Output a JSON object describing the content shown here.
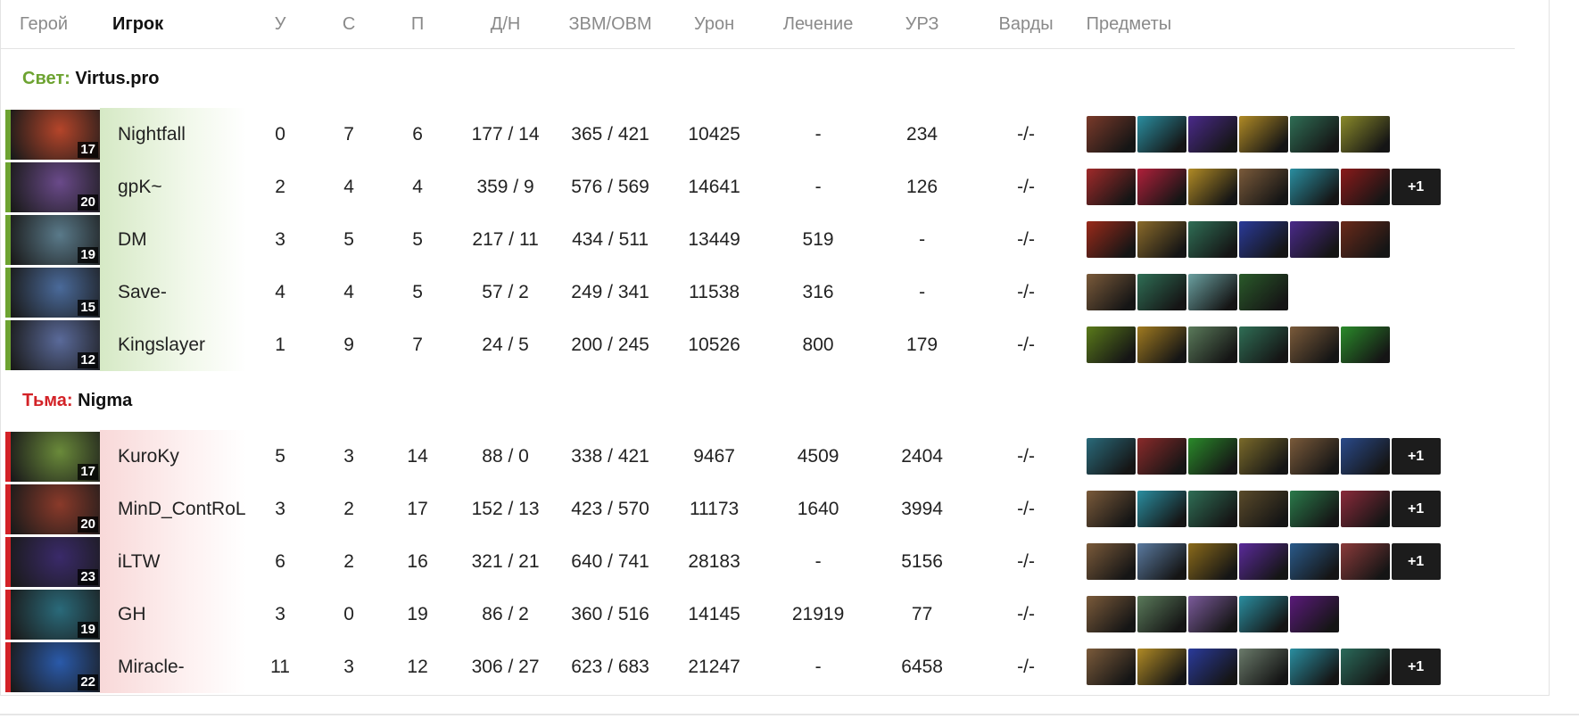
{
  "headers": {
    "hero": "Герой",
    "player": "Игрок",
    "kills": "У",
    "deaths": "С",
    "assists": "П",
    "lh_dn": "Д/Н",
    "gpm_xpm": "ЗВМ/ОВМ",
    "damage": "Урон",
    "healing": "Лечение",
    "building_damage": "УРЗ",
    "wards": "Варды",
    "items": "Предметы"
  },
  "teams": [
    {
      "side": "radiant",
      "side_label": "Свет:",
      "name": "Virtus.pro",
      "side_color": "#6da331",
      "players": [
        {
          "hero_icon": "hero-bearded-warrior-icon",
          "hero_color": "#b5452a",
          "level": "17",
          "name": "Nightfall",
          "k": "0",
          "d": "7",
          "a": "6",
          "lh": "177 / 14",
          "gx": "365 / 421",
          "dmg": "10425",
          "heal": "-",
          "bld": "234",
          "wards": "-/-",
          "items": [
            {
              "icon": "item-gauntlet-icon",
              "color": "#7a3a2a"
            },
            {
              "icon": "item-axe-blade-icon",
              "color": "#2a8ea0"
            },
            {
              "icon": "item-purple-robe-icon",
              "color": "#4a2a8a"
            },
            {
              "icon": "item-golden-helm-icon",
              "color": "#b08a25"
            },
            {
              "icon": "item-green-staff-icon",
              "color": "#2f6e55"
            },
            {
              "icon": "item-yellow-orb-icon",
              "color": "#8a8a2a"
            }
          ],
          "more": ""
        },
        {
          "hero_icon": "hero-masked-assassin-icon",
          "hero_color": "#6a4a8a",
          "level": "20",
          "name": "gpK~",
          "k": "2",
          "d": "4",
          "a": "4",
          "lh": "359 / 9",
          "gx": "576 / 569",
          "dmg": "14641",
          "heal": "-",
          "bld": "126",
          "wards": "-/-",
          "items": [
            {
              "icon": "item-red-blade-icon",
              "color": "#a02a2a"
            },
            {
              "icon": "item-crimson-cape-icon",
              "color": "#b0203a"
            },
            {
              "icon": "item-golden-helm-icon",
              "color": "#b08a25"
            },
            {
              "icon": "item-boots-icon",
              "color": "#7a5a3a"
            },
            {
              "icon": "item-axe-blade-icon",
              "color": "#2a8ea0"
            },
            {
              "icon": "item-red-claw-icon",
              "color": "#8a1a1a"
            }
          ],
          "more": "+1"
        },
        {
          "hero_icon": "hero-dwarf-icon",
          "hero_color": "#5a7a8a",
          "level": "19",
          "name": "DM",
          "k": "3",
          "d": "5",
          "a": "5",
          "lh": "217 / 11",
          "gx": "434 / 511",
          "dmg": "13449",
          "heal": "519",
          "bld": "-",
          "wards": "-/-",
          "items": [
            {
              "icon": "item-fire-shield-icon",
              "color": "#9a2a1a"
            },
            {
              "icon": "item-lantern-icon",
              "color": "#8a6a2a"
            },
            {
              "icon": "item-green-staff-icon",
              "color": "#2f6e55"
            },
            {
              "icon": "item-blue-scepter-icon",
              "color": "#2a3a9a"
            },
            {
              "icon": "item-purple-robe-icon",
              "color": "#4a2a8a"
            },
            {
              "icon": "item-hood-icon",
              "color": "#6a2a1a"
            }
          ],
          "more": ""
        },
        {
          "hero_icon": "hero-sorceress-icon",
          "hero_color": "#4a6a9a",
          "level": "15",
          "name": "Save-",
          "k": "4",
          "d": "4",
          "a": "5",
          "lh": "57 / 2",
          "gx": "249 / 341",
          "dmg": "11538",
          "heal": "316",
          "bld": "-",
          "wards": "-/-",
          "items": [
            {
              "icon": "item-boots-icon",
              "color": "#7a5a3a"
            },
            {
              "icon": "item-green-staff-icon",
              "color": "#2f6e55"
            },
            {
              "icon": "item-wind-cloud-icon",
              "color": "#6aa0a0"
            },
            {
              "icon": "item-green-ring-icon",
              "color": "#2a5a2a"
            }
          ],
          "more": ""
        },
        {
          "hero_icon": "hero-goblin-icon",
          "hero_color": "#5a6a9a",
          "level": "12",
          "name": "Kingslayer",
          "k": "1",
          "d": "9",
          "a": "7",
          "lh": "24 / 5",
          "gx": "200 / 245",
          "dmg": "10526",
          "heal": "800",
          "bld": "179",
          "wards": "-/-",
          "items": [
            {
              "icon": "item-green-trident-icon",
              "color": "#5a7a1a"
            },
            {
              "icon": "item-gold-pile-icon",
              "color": "#a07a20"
            },
            {
              "icon": "item-teal-mech-icon",
              "color": "#5a7a5a"
            },
            {
              "icon": "item-green-staff-icon",
              "color": "#2f6e55"
            },
            {
              "icon": "item-boots-icon",
              "color": "#7a5a3a"
            },
            {
              "icon": "item-green-potion-icon",
              "color": "#2a8a2a"
            }
          ],
          "more": ""
        }
      ]
    },
    {
      "side": "dire",
      "side_label": "Тьма:",
      "name": "Nigma",
      "side_color": "#d32227",
      "players": [
        {
          "hero_icon": "hero-nature-archer-icon",
          "hero_color": "#6a8a3a",
          "level": "17",
          "name": "KuroKy",
          "k": "5",
          "d": "3",
          "a": "14",
          "lh": "88 / 0",
          "gx": "338 / 421",
          "dmg": "9467",
          "heal": "4509",
          "bld": "2404",
          "wards": "-/-",
          "items": [
            {
              "icon": "item-teal-vase-icon",
              "color": "#2a6a7a"
            },
            {
              "icon": "item-red-armor-icon",
              "color": "#8a2a2a"
            },
            {
              "icon": "item-green-potion-icon",
              "color": "#2a8a2a"
            },
            {
              "icon": "item-mech-arm-icon",
              "color": "#7a6a2a"
            },
            {
              "icon": "item-boots-icon",
              "color": "#7a5a3a"
            },
            {
              "icon": "item-blue-vial-icon",
              "color": "#2a4a8a"
            }
          ],
          "more": "+1"
        },
        {
          "hero_icon": "hero-red-warrior-icon",
          "hero_color": "#8a3a2a",
          "level": "20",
          "name": "MinD_ContRoL",
          "k": "3",
          "d": "2",
          "a": "17",
          "lh": "152 / 13",
          "gx": "423 / 570",
          "dmg": "11173",
          "heal": "1640",
          "bld": "3994",
          "wards": "-/-",
          "items": [
            {
              "icon": "item-boots-icon",
              "color": "#7a5a3a"
            },
            {
              "icon": "item-axe-blade-icon",
              "color": "#2a8ea0"
            },
            {
              "icon": "item-green-staff-icon",
              "color": "#2f6e55"
            },
            {
              "icon": "item-dark-helm-icon",
              "color": "#5a4a2a"
            },
            {
              "icon": "item-green-gem-icon",
              "color": "#2a7a4a"
            },
            {
              "icon": "item-red-mask-icon",
              "color": "#8a2a3a"
            }
          ],
          "more": "+1"
        },
        {
          "hero_icon": "hero-void-spirit-icon",
          "hero_color": "#3a2a6a",
          "level": "23",
          "name": "iLTW",
          "k": "6",
          "d": "2",
          "a": "16",
          "lh": "321 / 21",
          "gx": "640 / 741",
          "dmg": "28183",
          "heal": "-",
          "bld": "5156",
          "wards": "-/-",
          "items": [
            {
              "icon": "item-boots-icon",
              "color": "#7a5a3a"
            },
            {
              "icon": "item-silver-blade-icon",
              "color": "#5a7aa0"
            },
            {
              "icon": "item-yin-yang-orb-icon",
              "color": "#8a6a1a"
            },
            {
              "icon": "item-purple-staff-icon",
              "color": "#5a2a9a"
            },
            {
              "icon": "item-blue-dagger-icon",
              "color": "#2a5a8a"
            },
            {
              "icon": "item-red-gauntlet-icon",
              "color": "#8a3a3a"
            }
          ],
          "more": "+1"
        },
        {
          "hero_icon": "hero-dragon-icon",
          "hero_color": "#2a6a7a",
          "level": "19",
          "name": "GH",
          "k": "3",
          "d": "0",
          "a": "19",
          "lh": "86 / 2",
          "gx": "360 / 516",
          "dmg": "14145",
          "heal": "21919",
          "bld": "77",
          "wards": "-/-",
          "items": [
            {
              "icon": "item-boots-icon",
              "color": "#7a5a3a"
            },
            {
              "icon": "item-teal-mech-icon",
              "color": "#5a7a5a"
            },
            {
              "icon": "item-gold-pouch-icon",
              "color": "#7a5a9a"
            },
            {
              "icon": "item-axe-blade-icon",
              "color": "#2a8ea0"
            },
            {
              "icon": "item-purple-ring-icon",
              "color": "#5a1a7a"
            }
          ],
          "more": ""
        },
        {
          "hero_icon": "hero-storm-spirit-icon",
          "hero_color": "#2a5aaa",
          "level": "22",
          "name": "Miracle-",
          "k": "11",
          "d": "3",
          "a": "12",
          "lh": "306 / 27",
          "gx": "623 / 683",
          "dmg": "21247",
          "heal": "-",
          "bld": "6458",
          "wards": "-/-",
          "items": [
            {
              "icon": "item-boots-icon",
              "color": "#7a5a3a"
            },
            {
              "icon": "item-golden-helm-icon",
              "color": "#b08a25"
            },
            {
              "icon": "item-blue-scepter-icon",
              "color": "#2a3a9a"
            },
            {
              "icon": "item-silver-wing-icon",
              "color": "#6a7a6a"
            },
            {
              "icon": "item-axe-blade-icon",
              "color": "#2a8ea0"
            },
            {
              "icon": "item-teal-armor-icon",
              "color": "#2a6a5a"
            }
          ],
          "more": "+1"
        }
      ]
    }
  ]
}
